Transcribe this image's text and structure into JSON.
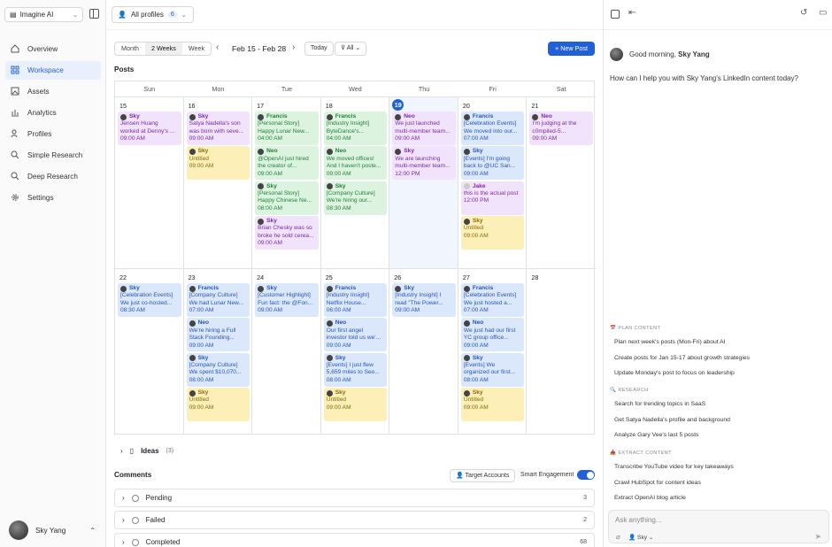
{
  "workspace": {
    "name": "Imagine AI"
  },
  "nav": [
    {
      "label": "Overview",
      "icon": "home-icon"
    },
    {
      "label": "Workspace",
      "icon": "grid-icon",
      "active": true
    },
    {
      "label": "Assets",
      "icon": "image-icon"
    },
    {
      "label": "Analytics",
      "icon": "chart-icon"
    },
    {
      "label": "Profiles",
      "icon": "users-icon"
    },
    {
      "label": "Simple Research",
      "icon": "search-icon"
    },
    {
      "label": "Deep Research",
      "icon": "search-icon"
    },
    {
      "label": "Settings",
      "icon": "gear-icon"
    }
  ],
  "user": {
    "name": "Sky Yang"
  },
  "header": {
    "profiles_label": "All profiles",
    "profiles_count": "6"
  },
  "toolbar": {
    "views": [
      "Month",
      "2 Weeks",
      "Week"
    ],
    "active_view": "2 Weeks",
    "range": "Feb 15 - Feb 28",
    "today": "Today",
    "filter": "All",
    "new_post": "+ New Post"
  },
  "posts_title": "Posts",
  "days": [
    "Sun",
    "Mon",
    "Tue",
    "Wed",
    "Thu",
    "Fri",
    "Sat"
  ],
  "weeks": [
    [
      {
        "date": "15",
        "events": [
          {
            "c": "purple",
            "who": "Sky",
            "text": [
              "Jensen Huang",
              "worked at Denny's ..."
            ],
            "time": "09:00 AM"
          }
        ]
      },
      {
        "date": "16",
        "events": [
          {
            "c": "purple",
            "who": "Sky",
            "text": [
              "Satya Nadella's son",
              "was born with seve..."
            ],
            "time": "09:00 AM"
          },
          {
            "c": "yellow",
            "who": "Sky",
            "text": [
              "Untitled"
            ],
            "time": "09:00 AM"
          }
        ]
      },
      {
        "date": "17",
        "events": [
          {
            "c": "green",
            "who": "Francis",
            "text": [
              "[Personal Story]",
              "Happy Lunar New..."
            ],
            "time": "04:00 AM"
          },
          {
            "c": "green",
            "who": "Neo",
            "text": [
              "@OpenAI just hired",
              "the creator of..."
            ],
            "time": "09:00 AM"
          },
          {
            "c": "green",
            "who": "Sky",
            "text": [
              "[Personal Story]",
              "Happy Chinese Ne..."
            ],
            "time": "08:00 AM"
          },
          {
            "c": "purple",
            "who": "Sky",
            "text": [
              "Brian Chesky was so",
              "broke he sold cerea..."
            ],
            "time": "09:00 AM"
          }
        ]
      },
      {
        "date": "18",
        "events": [
          {
            "c": "green",
            "who": "Francis",
            "text": [
              "[Industry Insight]",
              "ByteDance's..."
            ],
            "time": "04:00 AM"
          },
          {
            "c": "green",
            "who": "Neo",
            "text": [
              "We moved offices!",
              "And I haven't poste..."
            ],
            "time": "09:00 AM"
          },
          {
            "c": "green",
            "who": "Sky",
            "text": [
              "[Company Culture]",
              "We're hiring our..."
            ],
            "time": "08:30 AM"
          }
        ]
      },
      {
        "date": "19",
        "today": true,
        "events": [
          {
            "c": "purple",
            "who": "Neo",
            "text": [
              "We just launched",
              "multi-member team..."
            ],
            "time": "09:00 AM"
          },
          {
            "c": "purple",
            "who": "Sky",
            "text": [
              "We are launching",
              "multi-member team..."
            ],
            "time": "12:00 PM"
          }
        ]
      },
      {
        "date": "20",
        "events": [
          {
            "c": "blue",
            "who": "Francis",
            "text": [
              "[Celebration Events]",
              "We moved into our..."
            ],
            "time": "07:00 AM"
          },
          {
            "c": "blue",
            "who": "Sky",
            "text": [
              "[Events] I'm going",
              "back to @UC San..."
            ],
            "time": "09:00 AM"
          },
          {
            "c": "purple",
            "who": "Jake",
            "text": [
              "this is the actual post"
            ],
            "time": "12:00 PM"
          },
          {
            "c": "yellow",
            "who": "Sky",
            "text": [
              "Untitled"
            ],
            "time": "09:00 AM"
          }
        ]
      },
      {
        "date": "21",
        "events": [
          {
            "c": "purple",
            "who": "Neo",
            "text": [
              "I'm judging at the",
              "c0mpiled-5..."
            ],
            "time": "09:00 AM"
          }
        ]
      }
    ],
    [
      {
        "date": "22",
        "events": [
          {
            "c": "blue",
            "who": "Sky",
            "text": [
              "[Celebration Events]",
              "We just co-hosted..."
            ],
            "time": "08:30 AM"
          }
        ]
      },
      {
        "date": "23",
        "events": [
          {
            "c": "blue",
            "who": "Francis",
            "text": [
              "[Company Culture]",
              "We had Lunar New..."
            ],
            "time": "07:00 AM"
          },
          {
            "c": "blue",
            "who": "Neo",
            "text": [
              "We're hiring a Full",
              "Stack Founding..."
            ],
            "time": "09:00 AM"
          },
          {
            "c": "blue",
            "who": "Sky",
            "text": [
              "[Company Culture]",
              "We spent $10,070..."
            ],
            "time": "08:00 AM"
          },
          {
            "c": "yellow",
            "who": "Sky",
            "text": [
              "Untitled"
            ],
            "time": "09:00 AM"
          }
        ]
      },
      {
        "date": "24",
        "events": [
          {
            "c": "blue",
            "who": "Sky",
            "text": [
              "[Customer Highlight]",
              "Fun fact: the @Fon..."
            ],
            "time": "09:00 AM"
          }
        ]
      },
      {
        "date": "25",
        "events": [
          {
            "c": "blue",
            "who": "Francis",
            "text": [
              "[Industry Insight]",
              "Netflix House..."
            ],
            "time": "06:00 AM"
          },
          {
            "c": "blue",
            "who": "Neo",
            "text": [
              "Our first angel",
              "investor told us we'..."
            ],
            "time": "09:00 AM"
          },
          {
            "c": "blue",
            "who": "Sky",
            "text": [
              "[Events] I just flew",
              "5,659 miles to Seo..."
            ],
            "time": "08:00 AM"
          },
          {
            "c": "yellow",
            "who": "Sky",
            "text": [
              "Untitled"
            ],
            "time": "09:00 AM"
          }
        ]
      },
      {
        "date": "26",
        "events": [
          {
            "c": "blue",
            "who": "Sky",
            "text": [
              "[Industry Insight] I",
              "read \"The Power..."
            ],
            "time": "09:00 AM"
          }
        ]
      },
      {
        "date": "27",
        "events": [
          {
            "c": "blue",
            "who": "Francis",
            "text": [
              "[Celebration Events]",
              "We just hosted a..."
            ],
            "time": "07:00 AM"
          },
          {
            "c": "blue",
            "who": "Neo",
            "text": [
              "We just had our first",
              "YC group office..."
            ],
            "time": "09:00 AM"
          },
          {
            "c": "blue",
            "who": "Sky",
            "text": [
              "[Events] We",
              "organized our first..."
            ],
            "time": "08:00 AM"
          },
          {
            "c": "yellow",
            "who": "Sky",
            "text": [
              "Untitled"
            ],
            "time": "09:00 AM"
          }
        ]
      },
      {
        "date": "28",
        "events": []
      }
    ]
  ],
  "ideas": {
    "label": "Ideas",
    "count": "(3)"
  },
  "comments": {
    "title": "Comments",
    "target_accounts": "Target Accounts",
    "smart_engagement": "Smart Engagement",
    "rows": [
      {
        "label": "Pending",
        "count": "3"
      },
      {
        "label": "Failed",
        "count": "2"
      },
      {
        "label": "Completed",
        "count": "68"
      }
    ]
  },
  "assistant": {
    "greeting": "Good morning,",
    "greeting_name": "Sky Yang",
    "question": "How can I help you with Sky Yang's LinkedIn content today?",
    "sections": [
      {
        "title": "PLAN CONTENT",
        "icon": "calendar-icon",
        "items": [
          "Plan next week's posts (Mon-Fri) about AI",
          "Create posts for Jan 15-17 about growth strategies",
          "Update Monday's post to focus on leadership"
        ]
      },
      {
        "title": "RESEARCH",
        "icon": "search-icon",
        "items": [
          "Search for trending topics in SaaS",
          "Get Satya Nadella's profile and background",
          "Analyze Gary Vee's last 5 posts"
        ]
      },
      {
        "title": "EXTRACT CONTENT",
        "icon": "extract-icon",
        "items": [
          "Transcribe YouTube video for key takeaways",
          "Crawl HubSpot for content ideas",
          "Extract OpenAI blog article"
        ]
      }
    ],
    "input_placeholder": "Ask anything...",
    "profile_chip": "Sky"
  }
}
